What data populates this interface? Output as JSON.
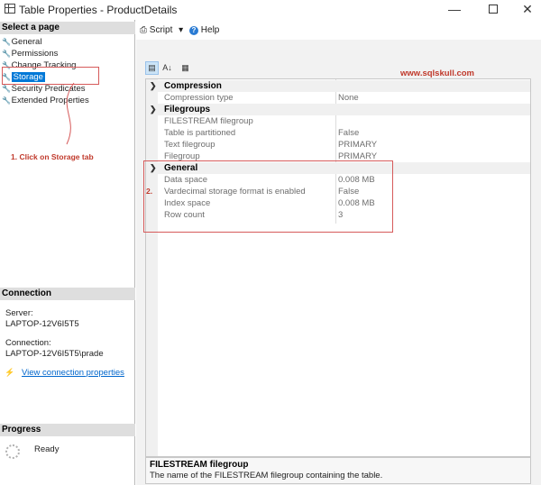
{
  "window": {
    "title": "Table Properties - ProductDetails",
    "min_glyph": "—",
    "close_glyph": "✕"
  },
  "left": {
    "select_page_header": "Select a page",
    "pages": [
      {
        "label": "General",
        "selected": false
      },
      {
        "label": "Permissions",
        "selected": false
      },
      {
        "label": "Change Tracking",
        "selected": false
      },
      {
        "label": "Storage",
        "selected": true
      },
      {
        "label": "Security Predicates",
        "selected": false
      },
      {
        "label": "Extended Properties",
        "selected": false
      }
    ],
    "connection_header": "Connection",
    "server_label": "Server:",
    "server_value": "LAPTOP-12V6I5T5",
    "connection_label": "Connection:",
    "connection_value": "LAPTOP-12V6I5T5\\prade",
    "view_connection_link": "View connection properties",
    "progress_header": "Progress",
    "progress_status": "Ready"
  },
  "toolbar": {
    "script_label": "Script",
    "help_label": "Help"
  },
  "annotations": {
    "step1": "1.  Click on Storage tab",
    "step2": "2.",
    "watermark": "www.sqlskull.com"
  },
  "grid": {
    "categories": [
      {
        "name": "Compression",
        "properties": [
          {
            "name": "Compression type",
            "value": "None"
          }
        ]
      },
      {
        "name": "Filegroups",
        "properties": [
          {
            "name": "FILESTREAM filegroup",
            "value": ""
          },
          {
            "name": "Table is partitioned",
            "value": "False"
          },
          {
            "name": "Text filegroup",
            "value": "PRIMARY"
          },
          {
            "name": "Filegroup",
            "value": "PRIMARY"
          }
        ]
      },
      {
        "name": "General",
        "properties": [
          {
            "name": "Data space",
            "value": "0.008 MB"
          },
          {
            "name": "Vardecimal storage format is enabled",
            "value": "False"
          },
          {
            "name": "Index space",
            "value": "0.008 MB"
          },
          {
            "name": "Row count",
            "value": "3"
          }
        ]
      }
    ]
  },
  "description": {
    "title": "FILESTREAM filegroup",
    "body": "The name of the FILESTREAM filegroup containing the table."
  },
  "colors": {
    "accent": "#0078d7",
    "annotation": "#c0392b",
    "link": "#0066cc"
  }
}
